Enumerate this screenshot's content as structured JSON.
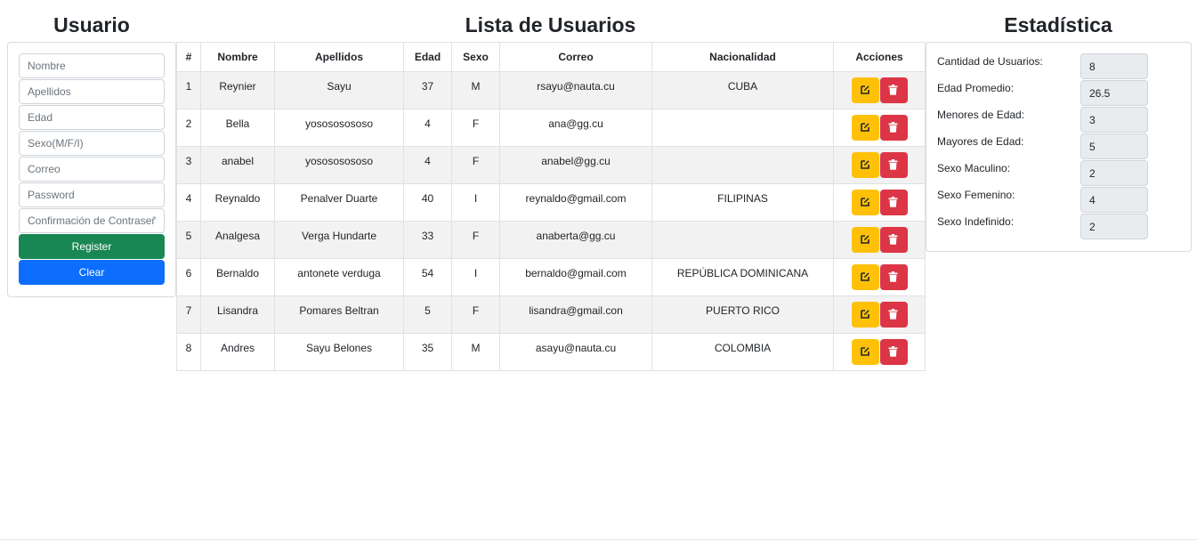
{
  "headings": {
    "usuario": "Usuario",
    "lista": "Lista de Usuarios",
    "estadistica": "Estadística"
  },
  "form": {
    "fields": [
      {
        "name": "nombre-input",
        "placeholder": "Nombre",
        "value": ""
      },
      {
        "name": "apellidos-input",
        "placeholder": "Apellidos",
        "value": ""
      },
      {
        "name": "edad-input",
        "placeholder": "Edad",
        "value": ""
      },
      {
        "name": "sexo-input",
        "placeholder": "Sexo(M/F/I)",
        "value": ""
      },
      {
        "name": "correo-input",
        "placeholder": "Correo",
        "value": ""
      },
      {
        "name": "password-input",
        "placeholder": "Password",
        "value": ""
      },
      {
        "name": "password-confirm-input",
        "placeholder": "Confirmación de Contraseña",
        "value": ""
      }
    ],
    "register_label": "Register",
    "clear_label": "Clear"
  },
  "table": {
    "columns": [
      "#",
      "Nombre",
      "Apellidos",
      "Edad",
      "Sexo",
      "Correo",
      "Nacionalidad",
      "Acciones"
    ],
    "rows": [
      {
        "id": "1",
        "nombre": "Reynier",
        "apellidos": "Sayu",
        "edad": "37",
        "sexo": "M",
        "correo": "rsayu@nauta.cu",
        "nacionalidad": "CUBA"
      },
      {
        "id": "2",
        "nombre": "Bella",
        "apellidos": "yosososososo",
        "edad": "4",
        "sexo": "F",
        "correo": "ana@gg.cu",
        "nacionalidad": ""
      },
      {
        "id": "3",
        "nombre": "anabel",
        "apellidos": "yosososososo",
        "edad": "4",
        "sexo": "F",
        "correo": "anabel@gg.cu",
        "nacionalidad": ""
      },
      {
        "id": "4",
        "nombre": "Reynaldo",
        "apellidos": "Penalver Duarte",
        "edad": "40",
        "sexo": "I",
        "correo": "reynaldo@gmail.com",
        "nacionalidad": "FILIPINAS"
      },
      {
        "id": "5",
        "nombre": "Analgesa",
        "apellidos": "Verga Hundarte",
        "edad": "33",
        "sexo": "F",
        "correo": "anaberta@gg.cu",
        "nacionalidad": ""
      },
      {
        "id": "6",
        "nombre": "Bernaldo",
        "apellidos": "antonete verduga",
        "edad": "54",
        "sexo": "I",
        "correo": "bernaldo@gmail.com",
        "nacionalidad": "REPÚBLICA DOMINICANA"
      },
      {
        "id": "7",
        "nombre": "Lisandra",
        "apellidos": "Pomares Beltran",
        "edad": "5",
        "sexo": "F",
        "correo": "lisandra@gmail.con",
        "nacionalidad": "PUERTO RICO"
      },
      {
        "id": "8",
        "nombre": "Andres",
        "apellidos": "Sayu Belones",
        "edad": "35",
        "sexo": "M",
        "correo": "asayu@nauta.cu",
        "nacionalidad": "COLOMBIA"
      }
    ],
    "action_icons": [
      "edit-icon",
      "trash-icon"
    ]
  },
  "stats": [
    {
      "label": "Cantidad de Usuarios:",
      "value": "8"
    },
    {
      "label": "Edad Promedio:",
      "value": "26.5"
    },
    {
      "label": "Menores de Edad:",
      "value": "3"
    },
    {
      "label": "Mayores de Edad:",
      "value": "5"
    },
    {
      "label": "Sexo Maculino:",
      "value": "2"
    },
    {
      "label": "Sexo Femenino:",
      "value": "4"
    },
    {
      "label": "Sexo Indefinido:",
      "value": "2"
    }
  ],
  "colors": {
    "register": "#198754",
    "clear": "#0d6efd",
    "edit": "#ffc107",
    "delete": "#dc3545",
    "stripe": "#f2f2f2"
  }
}
